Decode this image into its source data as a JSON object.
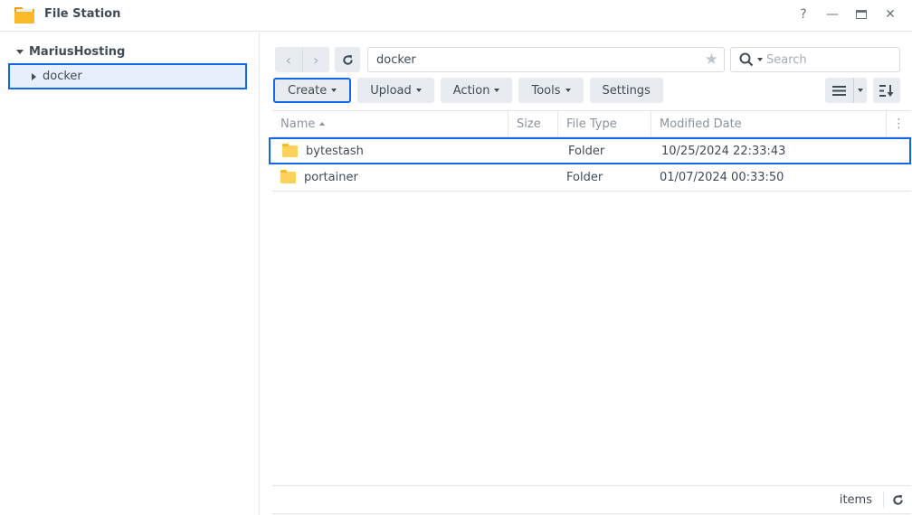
{
  "window": {
    "title": "File Station",
    "app_icon": "folder-icon",
    "controls": [
      {
        "name": "help",
        "glyph": "?"
      },
      {
        "name": "minimize",
        "glyph": "—"
      },
      {
        "name": "maximize",
        "glyph": "▭"
      },
      {
        "name": "close",
        "glyph": "✕"
      }
    ]
  },
  "sidebar": {
    "root": "MariusHosting",
    "items": [
      {
        "label": "docker",
        "selected": true
      }
    ]
  },
  "navigation": {
    "back_glyph": "‹",
    "forward_glyph": "›",
    "refresh_glyph": "↻",
    "path": "docker",
    "favorite_glyph": "★",
    "search_placeholder": "Search"
  },
  "toolbar": {
    "buttons": [
      {
        "label": "Create",
        "dropdown": true,
        "selected": true
      },
      {
        "label": "Upload",
        "dropdown": true
      },
      {
        "label": "Action",
        "dropdown": true
      },
      {
        "label": "Tools",
        "dropdown": true
      },
      {
        "label": "Settings",
        "dropdown": false
      }
    ]
  },
  "table": {
    "columns": [
      "Name",
      "Size",
      "File Type",
      "Modified Date"
    ],
    "sort_column": "Name",
    "rows": [
      {
        "name": "bytestash",
        "size": "",
        "type": "Folder",
        "modified": "10/25/2024 22:33:43",
        "selected": true
      },
      {
        "name": "portainer",
        "size": "",
        "type": "Folder",
        "modified": "01/07/2024 00:33:50",
        "selected": false
      }
    ]
  },
  "footer": {
    "items_label": "items"
  },
  "colors": {
    "accent": "#1168e6",
    "selection_bg": "#e6f0fc",
    "folder": "#fdd25a"
  }
}
